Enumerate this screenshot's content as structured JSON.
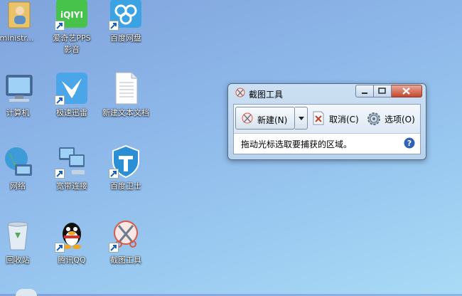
{
  "desktop": {
    "icons": [
      {
        "name": "administrator-folder",
        "label": "dministr..."
      },
      {
        "name": "iqiyi-pps",
        "label": "爱奇艺PPS\n影音",
        "badge": "iQIYI"
      },
      {
        "name": "baidu-pan",
        "label": "百度网盘"
      },
      {
        "name": "computer",
        "label": "计算机"
      },
      {
        "name": "xunlei",
        "label": "极速迅雷"
      },
      {
        "name": "new-text-doc",
        "label": "新建文本文档"
      },
      {
        "name": "network",
        "label": "网络"
      },
      {
        "name": "broadband",
        "label": "宽带连接"
      },
      {
        "name": "baidu-guard",
        "label": "百度卫士"
      },
      {
        "name": "recycle-bin",
        "label": "回收站"
      },
      {
        "name": "tencent-qq",
        "label": "腾讯QQ"
      },
      {
        "name": "snipping-tool",
        "label": "截图工具"
      }
    ]
  },
  "snip_window": {
    "title": "截图工具",
    "toolbar": {
      "new_label": "新建(N)",
      "cancel_label": "取消(C)",
      "options_label": "选项(O)"
    },
    "status": "拖动光标选取要捕获的区域。"
  },
  "colors": {
    "desktop_top": "#7fa3dc",
    "desktop_bottom": "#a9dbf6",
    "window_frame": "#b9d2ec",
    "close_red": "#c4492f"
  }
}
